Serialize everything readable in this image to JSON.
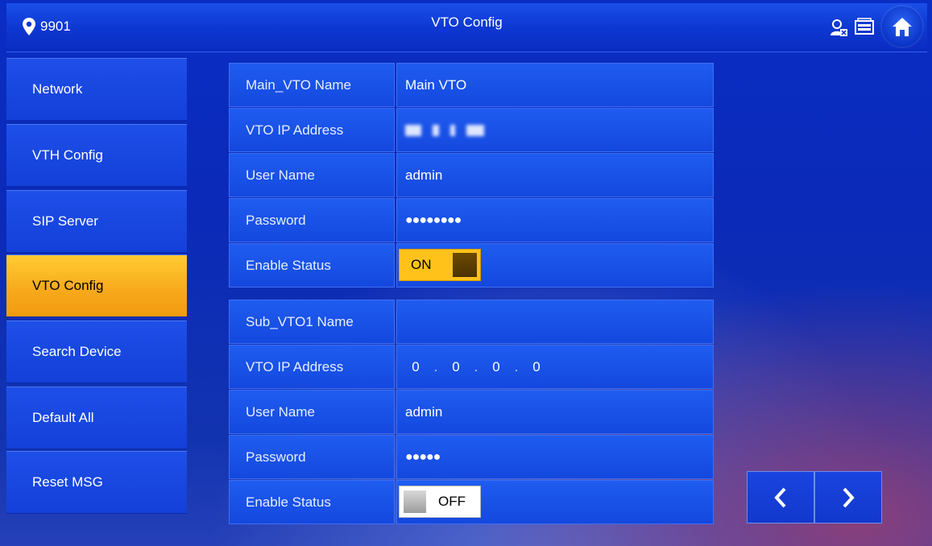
{
  "header": {
    "room_number": "9901",
    "title": "VTO Config",
    "icons": [
      "location-pin-icon",
      "contact-status-icon",
      "message-icon",
      "home-icon"
    ]
  },
  "sidebar": {
    "items": [
      {
        "label": "Network"
      },
      {
        "label": "VTH Config"
      },
      {
        "label": "SIP Server"
      },
      {
        "label": "VTO Config",
        "active": true
      },
      {
        "label": "Search Device"
      },
      {
        "label": "Default All"
      },
      {
        "label": "Reset MSG"
      }
    ]
  },
  "main_vto": {
    "name_label": "Main_VTO Name",
    "name_value": "Main VTO",
    "ip_label": "VTO IP Address",
    "ip_value_obscured": true,
    "user_label": "User Name",
    "user_value": "admin",
    "password_label": "Password",
    "password_value": "●●●●●●●●",
    "status_label": "Enable Status",
    "status_value": "ON"
  },
  "sub_vto1": {
    "name_label": "Sub_VTO1 Name",
    "name_value": "",
    "ip_label": "VTO IP Address",
    "ip_octets": [
      "0",
      "0",
      "0",
      "0"
    ],
    "user_label": "User Name",
    "user_value": "admin",
    "password_label": "Password",
    "password_value": "●●●●●",
    "status_label": "Enable Status",
    "status_value": "OFF"
  },
  "pager": {
    "prev": "‹",
    "next": "›"
  },
  "colors": {
    "accent_active": "#f7a81a",
    "toggle_on": "#ffc21a",
    "panel_blue": "#1f5cf0"
  }
}
